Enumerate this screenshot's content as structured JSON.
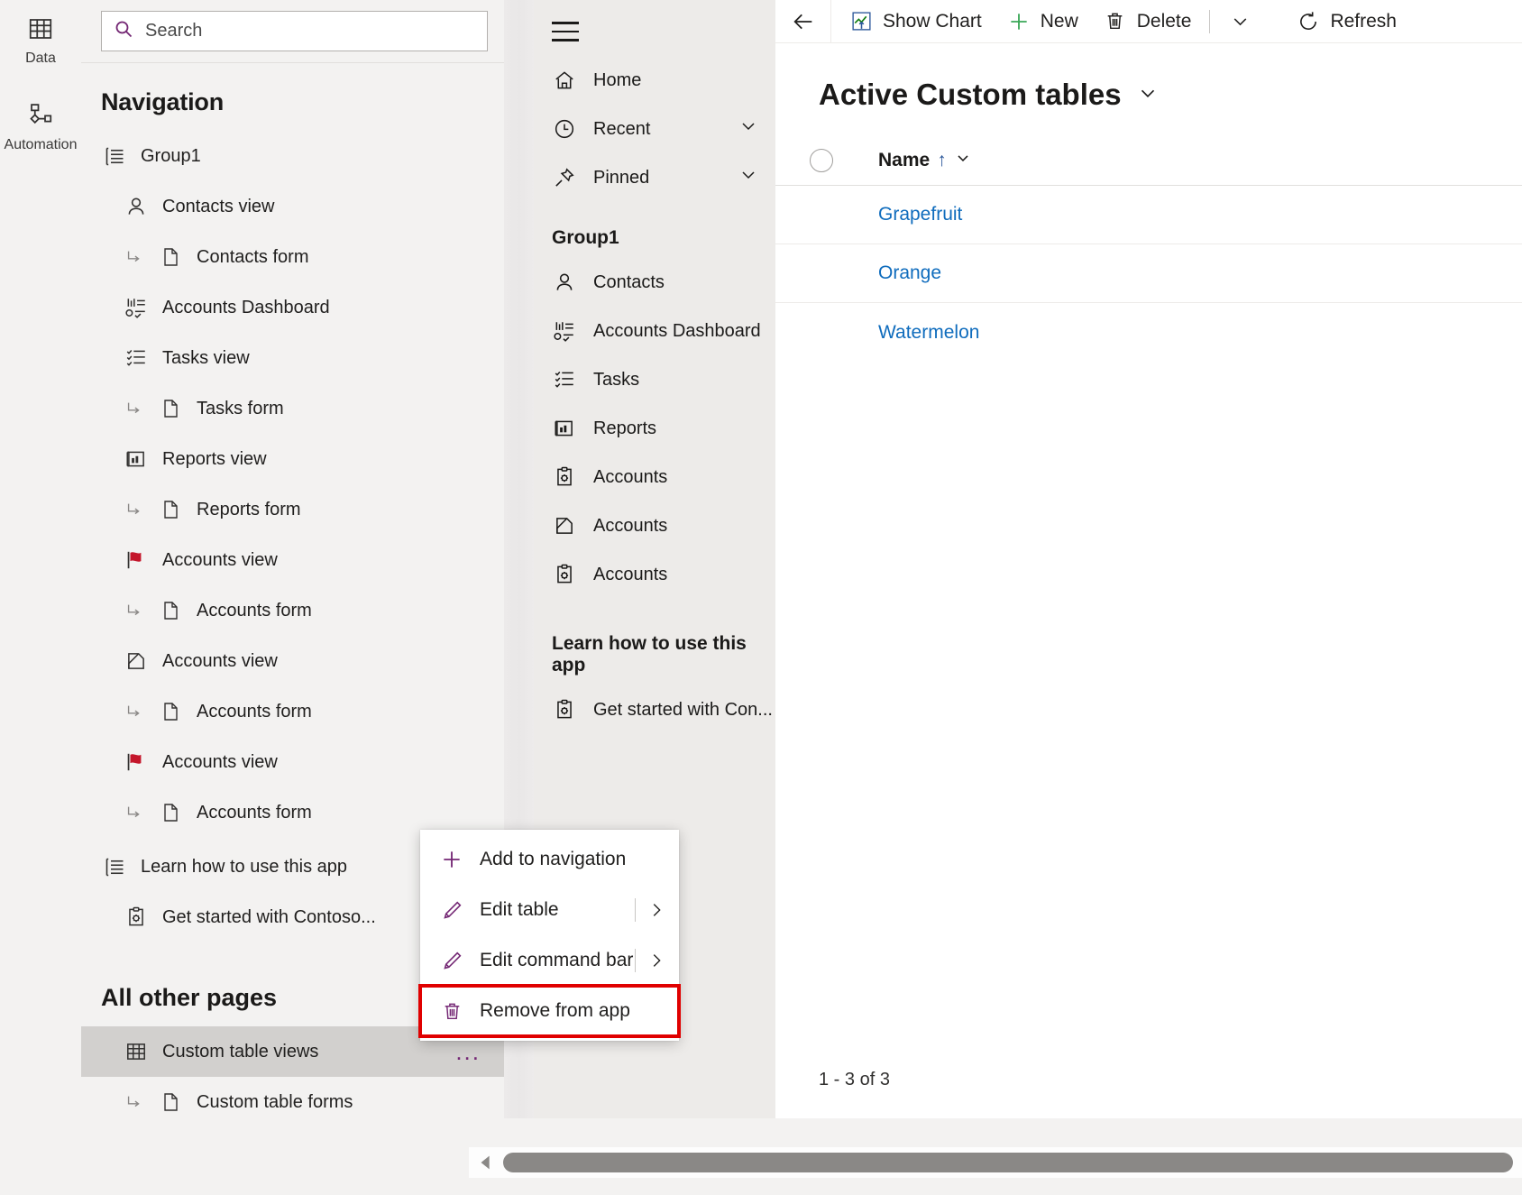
{
  "rail": {
    "items": [
      {
        "label": "Data",
        "icon": "table-icon"
      },
      {
        "label": "Automation",
        "icon": "automation-icon"
      }
    ],
    "bot_icon": "copilot-bot-icon"
  },
  "designer": {
    "search": {
      "placeholder": "Search",
      "value": "",
      "icon": "search-icon"
    },
    "navigation_title": "Navigation",
    "tree": [
      {
        "label": "Group1",
        "icon": "group-list-icon",
        "level": 0
      },
      {
        "label": "Contacts view",
        "icon": "contact-icon",
        "level": 1
      },
      {
        "label": "Contacts form",
        "icon": "page-icon",
        "level": 2
      },
      {
        "label": "Accounts Dashboard",
        "icon": "dashboard-icon",
        "level": 1
      },
      {
        "label": "Tasks view",
        "icon": "task-list-icon",
        "level": 1
      },
      {
        "label": "Tasks form",
        "icon": "page-icon",
        "level": 2
      },
      {
        "label": "Reports view",
        "icon": "report-icon",
        "level": 1
      },
      {
        "label": "Reports form",
        "icon": "page-icon",
        "level": 2
      },
      {
        "label": "Accounts view",
        "icon": "red-flag-icon",
        "level": 1
      },
      {
        "label": "Accounts form",
        "icon": "page-icon",
        "level": 2
      },
      {
        "label": "Accounts view",
        "icon": "folder-view-icon",
        "level": 1
      },
      {
        "label": "Accounts form",
        "icon": "page-icon",
        "level": 2
      },
      {
        "label": "Accounts view",
        "icon": "red-flag-icon",
        "level": 1
      },
      {
        "label": "Accounts form",
        "icon": "page-icon",
        "level": 2
      },
      {
        "label": "Learn how to use this app",
        "icon": "group-list-icon",
        "level": 0
      },
      {
        "label": "Get started with Contoso...",
        "icon": "clipboard-gear-icon",
        "level": 1
      }
    ],
    "all_other_pages_title": "All other pages",
    "other_pages": [
      {
        "label": "Custom table views",
        "icon": "table-icon",
        "level": 1,
        "selected": true,
        "overflow": "..."
      },
      {
        "label": "Custom table forms",
        "icon": "page-icon",
        "level": 2,
        "selected": false
      }
    ]
  },
  "context_menu": {
    "items": [
      {
        "label": "Add to navigation",
        "icon": "plus-icon",
        "submenu": false,
        "highlighted": false
      },
      {
        "label": "Edit table",
        "icon": "pencil-icon",
        "submenu": true,
        "highlighted": false
      },
      {
        "label": "Edit command bar",
        "icon": "pencil-icon",
        "submenu": true,
        "highlighted": false
      },
      {
        "label": "Remove from app",
        "icon": "trash-icon",
        "submenu": false,
        "highlighted": true
      }
    ],
    "highlight_color": "#e00000"
  },
  "preview": {
    "hamburger_icon": "hamburger-icon",
    "top_items": [
      {
        "label": "Home",
        "icon": "home-icon",
        "chevron": false
      },
      {
        "label": "Recent",
        "icon": "clock-icon",
        "chevron": true
      },
      {
        "label": "Pinned",
        "icon": "pin-icon",
        "chevron": true
      }
    ],
    "group_label": "Group1",
    "group_items": [
      {
        "label": "Contacts",
        "icon": "contact-icon"
      },
      {
        "label": "Accounts Dashboard",
        "icon": "dashboard-icon"
      },
      {
        "label": "Tasks",
        "icon": "task-list-icon"
      },
      {
        "label": "Reports",
        "icon": "report-icon"
      },
      {
        "label": "Accounts",
        "icon": "clipboard-gear-icon"
      },
      {
        "label": "Accounts",
        "icon": "folder-view-icon"
      },
      {
        "label": "Accounts",
        "icon": "clipboard-gear-icon"
      }
    ],
    "learn_label": "Learn how to use this app",
    "learn_items": [
      {
        "label": "Get started with Con...",
        "icon": "clipboard-gear-icon"
      }
    ]
  },
  "content": {
    "command_bar": {
      "back_icon": "back-arrow-icon",
      "commands": [
        {
          "label": "Show Chart",
          "icon": "show-chart-icon"
        },
        {
          "label": "New",
          "icon": "plus-icon"
        },
        {
          "label": "Delete",
          "icon": "trash-icon"
        }
      ],
      "overflow_icon": "chevron-down-icon",
      "refresh": {
        "label": "Refresh",
        "icon": "refresh-icon"
      }
    },
    "view_title": "Active Custom tables",
    "view_title_chevron": "chevron-down-icon",
    "grid": {
      "select_all_icon": "select-all-circle",
      "columns": [
        {
          "label": "Name",
          "sort": "↑",
          "chevron": "chevron-down-icon"
        }
      ],
      "rows": [
        {
          "name": "Grapefruit"
        },
        {
          "name": "Orange"
        },
        {
          "name": "Watermelon"
        }
      ]
    },
    "pager_text": "1 - 3 of 3"
  },
  "scrollbar": {
    "left_arrow_icon": "scroll-left-arrow-icon"
  },
  "colors": {
    "accent_purple": "#742774",
    "link_blue": "#0f6cbd",
    "flag_red": "#c4162b",
    "new_green": "#3aa757",
    "highlight_red": "#e00000"
  }
}
